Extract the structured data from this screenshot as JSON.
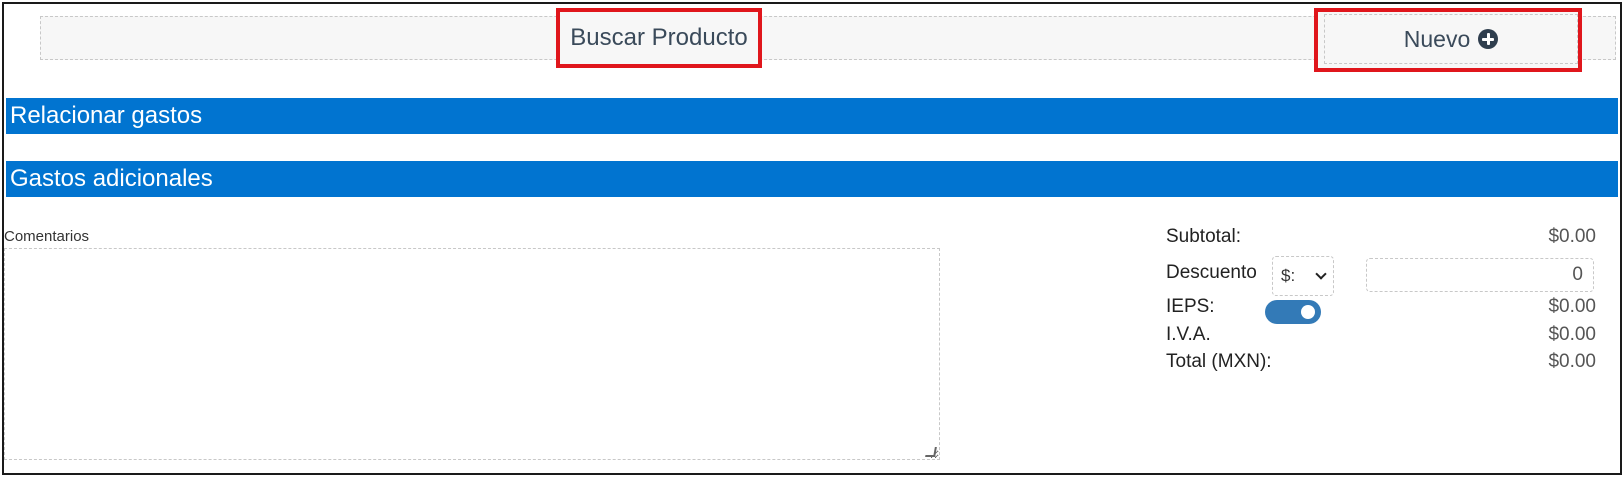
{
  "toolbar": {
    "search_label": "Buscar Producto",
    "new_label": "Nuevo"
  },
  "sections": {
    "related_expenses": "Relacionar gastos",
    "additional_expenses": "Gastos adicionales"
  },
  "comments": {
    "label": "Comentarios",
    "value": ""
  },
  "totals": {
    "subtotal_label": "Subtotal:",
    "subtotal_value": "$0.00",
    "discount_label": "Descuento",
    "discount_currency": "$:",
    "discount_value": "0",
    "ieps_label": "IEPS:",
    "ieps_enabled": true,
    "ieps_value": "$0.00",
    "iva_label": "I.V.A.",
    "iva_value": "$0.00",
    "total_label": "Total (MXN):",
    "total_value": "$0.00"
  },
  "colors": {
    "section_bar": "#0174d0",
    "highlight_outline": "#e0161c",
    "toggle_on": "#337ab7"
  }
}
